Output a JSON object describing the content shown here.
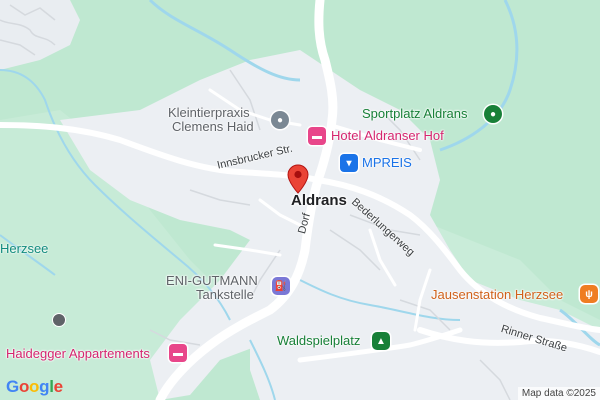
{
  "map": {
    "town_label": "Aldrans",
    "places": [
      {
        "id": "kleintierpraxis",
        "lines": [
          "Kleintierpraxis",
          "Clemens Haid"
        ],
        "icon": "vet-icon"
      },
      {
        "id": "hotel",
        "text": "Hotel Aldranser Hof",
        "icon": "hotel-icon"
      },
      {
        "id": "mpreis",
        "text": "MPREIS",
        "icon": "shopping-cart-icon"
      },
      {
        "id": "sportplatz",
        "text": "Sportplatz Aldrans",
        "icon": "park-pin-icon"
      },
      {
        "id": "eni",
        "lines": [
          "ENI-GUTMANN",
          "Tankstelle"
        ],
        "icon": "gas-station-icon"
      },
      {
        "id": "jausenstation",
        "text": "Jausenstation Herzsee",
        "icon": "restaurant-icon"
      },
      {
        "id": "waldspielplatz",
        "text": "Waldspielplatz",
        "icon": "tree-icon"
      },
      {
        "id": "haidegger",
        "text": "Haidegger Appartements",
        "icon": "hotel-icon"
      },
      {
        "id": "herzsee",
        "text": "Herzsee"
      }
    ],
    "streets": {
      "innsbrucker": "Innsbrucker Str.",
      "dorf": "Dorf",
      "bederlungerweg": "Bederlungerweg",
      "rinner": "Rinner Straße"
    },
    "attribution": "Map data ©2025",
    "logo_letters": [
      "G",
      "o",
      "o",
      "g",
      "l",
      "e"
    ],
    "colors": {
      "park": "#b9e6cc",
      "urban": "#eceff3",
      "land": "#f8f9fa",
      "road": "#ffffff",
      "water": "#9fd7ec",
      "pin": "#ea4335",
      "logo": [
        "#4285f4",
        "#ea4335",
        "#fbbc05",
        "#4285f4",
        "#34a853",
        "#ea4335"
      ]
    }
  }
}
